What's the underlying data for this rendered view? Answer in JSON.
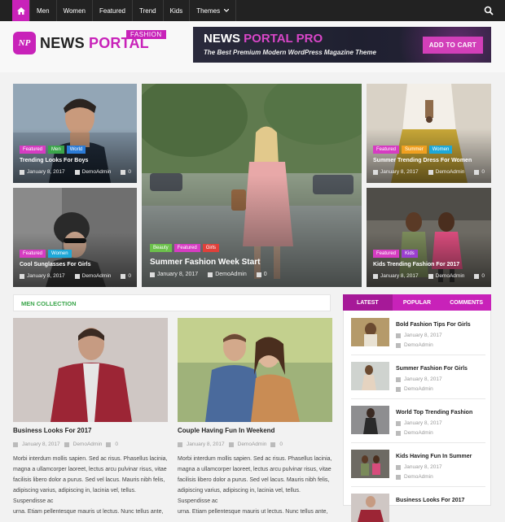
{
  "nav": {
    "items": [
      "Men",
      "Women",
      "Featured",
      "Trend",
      "Kids",
      "Themes"
    ]
  },
  "header": {
    "logo_badge": "NP",
    "logo_word1": "NEWS",
    "logo_word2": "PORTAL",
    "logo_tag": "FASHION",
    "banner_title_1": "NEWS",
    "banner_title_2": "PORTAL PRO",
    "banner_subtitle": "The Best Premium Modern WordPress Magazine Theme",
    "banner_cta": "ADD TO CART"
  },
  "hero": {
    "t1": {
      "tags": [
        "Featured",
        "Men",
        "World"
      ],
      "title": "Trending Looks For Boys",
      "date": "January 8, 2017",
      "author": "DemoAdmin",
      "comments": "0"
    },
    "t2": {
      "tags": [
        "Featured",
        "Women"
      ],
      "title": "Cool Sunglasses For Girls",
      "date": "January 8, 2017",
      "author": "DemoAdmin",
      "comments": "0"
    },
    "t3": {
      "tags": [
        "Beauty",
        "Featured",
        "Girls"
      ],
      "title": "Summer Fashion Week Start",
      "date": "January 8, 2017",
      "author": "DemoAdmin",
      "comments": "0"
    },
    "t4": {
      "tags": [
        "Featured",
        "Summer",
        "Women"
      ],
      "title": "Summer Trending Dress For Women",
      "date": "January 8, 2017",
      "author": "DemoAdmin",
      "comments": "0"
    },
    "t5": {
      "tags": [
        "Featured",
        "Kids"
      ],
      "title": "Kids Trending Fashion For 2017",
      "date": "January 8, 2017",
      "author": "DemoAdmin",
      "comments": "0"
    }
  },
  "men": {
    "heading": "MEN COLLECTION",
    "posts": [
      {
        "title": "Business Looks For 2017",
        "date": "January 8, 2017",
        "author": "DemoAdmin",
        "comments": "0",
        "excerpt": [
          "Morbi interdum mollis sapien. Sed ac risus. Phasellus lacinia,",
          "magna a ullamcorper laoreet, lectus arcu pulvinar risus, vitae",
          "facilisis libero dolor a purus. Sed vel lacus. Mauris nibh felis,",
          "adipiscing varius, adipiscing in, lacinia vel, tellus. Suspendisse ac",
          "urna. Etiam pellentesque mauris ut lectus. Nunc tellus ante,"
        ]
      },
      {
        "title": "Couple Having Fun In Weekend",
        "date": "January 8, 2017",
        "author": "DemoAdmin",
        "comments": "0",
        "excerpt": [
          "Morbi interdum mollis sapien. Sed ac risus. Phasellus lacinia,",
          "magna a ullamcorper laoreet, lectus arcu pulvinar risus, vitae",
          "facilisis libero dolor a purus. Sed vel lacus. Mauris nibh felis,",
          "adipiscing varius, adipiscing in, lacinia vel, tellus. Suspendisse ac",
          "urna. Etiam pellentesque mauris ut lectus. Nunc tellus ante,"
        ]
      }
    ]
  },
  "sidebar": {
    "tabs": [
      "LATEST",
      "POPULAR",
      "COMMENTS"
    ],
    "items": [
      {
        "title": "Bold Fashion Tips For Girls",
        "date": "January 8, 2017",
        "author": "DemoAdmin"
      },
      {
        "title": "Summer Fashion For Girls",
        "date": "January 8, 2017",
        "author": "DemoAdmin"
      },
      {
        "title": "World Top Trending Fashion",
        "date": "January 8, 2017",
        "author": "DemoAdmin"
      },
      {
        "title": "Kids Having Fun In Summer",
        "date": "January 8, 2017",
        "author": "DemoAdmin"
      },
      {
        "title": "Business Looks For 2017",
        "date": "",
        "author": ""
      }
    ]
  },
  "colors": {
    "accent": "#c822b9",
    "tag_featured": "#d63cc2",
    "tag_men": "#3aa54a",
    "tag_world": "#2b7bd6",
    "tag_women": "#1ea8d8",
    "tag_beauty": "#6bc04b",
    "tag_girls": "#e0403a",
    "tag_summer": "#f0a020",
    "tag_kids": "#9b3fd0",
    "section_green": "#3aa54a"
  }
}
